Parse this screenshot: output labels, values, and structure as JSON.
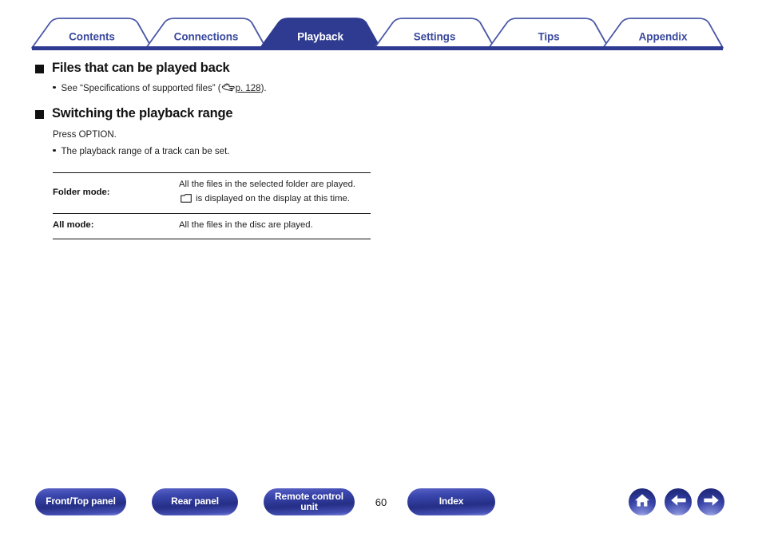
{
  "colors": {
    "brand_blue": "#3b4a9e",
    "active_tab_fill": "#2f3b90",
    "tab_border": "#4a57a8",
    "rule_black": "#121212",
    "text": "#1e1e1e"
  },
  "tabs": [
    {
      "label": "Contents",
      "active": false
    },
    {
      "label": "Connections",
      "active": false
    },
    {
      "label": "Playback",
      "active": true
    },
    {
      "label": "Settings",
      "active": false
    },
    {
      "label": "Tips",
      "active": false
    },
    {
      "label": "Appendix",
      "active": false
    }
  ],
  "sections": [
    {
      "heading": "Files that can be played back",
      "bullet_prefix": "See “Specifications of supported files” (",
      "link_text": "p. 128",
      "bullet_suffix": ")."
    },
    {
      "heading": "Switching the playback range",
      "intro": "Press OPTION.",
      "bullet": "The playback range of a track can be set."
    }
  ],
  "table": {
    "rows": [
      {
        "name": "Folder mode:",
        "desc_before": "All the files in the selected folder are played. ",
        "desc_after": " is displayed on the display at this time.",
        "has_folder_icon": true
      },
      {
        "name": "All mode:",
        "desc_before": "All the files in the disc are played.",
        "desc_after": "",
        "has_folder_icon": false
      }
    ]
  },
  "footer": {
    "buttons": [
      {
        "label": "Front/Top panel"
      },
      {
        "label": "Rear panel"
      },
      {
        "label": "Remote control unit"
      },
      {
        "label": "Index"
      }
    ],
    "page_number": "60",
    "nav_icons": [
      {
        "name": "home-icon"
      },
      {
        "name": "arrow-left-icon"
      },
      {
        "name": "arrow-right-icon"
      }
    ]
  }
}
